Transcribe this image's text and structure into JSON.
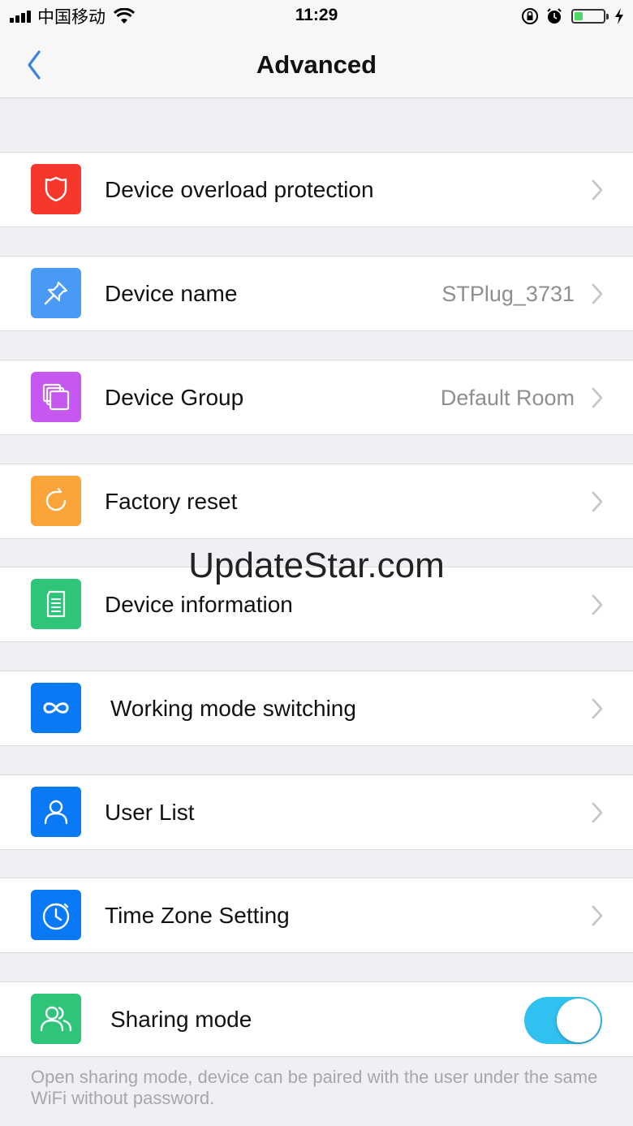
{
  "status_bar": {
    "carrier": "中国移动",
    "time": "11:29",
    "battery_level": 0.3
  },
  "nav": {
    "title": "Advanced",
    "back_icon": "chevron-left-icon"
  },
  "rows": [
    {
      "label": "Device overload protection",
      "value": "",
      "icon": "shield-icon",
      "color": "#f5382b"
    },
    {
      "label": "Device name",
      "value": "STPlug_3731",
      "icon": "pushpin-icon",
      "color": "#4a9af5"
    },
    {
      "label": "Device Group",
      "value": "Default Room",
      "icon": "stacked-squares-icon",
      "color": "#c657f0"
    },
    {
      "label": "Factory reset",
      "value": "",
      "icon": "refresh-icon",
      "color": "#fba43a"
    },
    {
      "label": "Device information",
      "value": "",
      "icon": "document-icon",
      "color": "#2ec57a"
    },
    {
      "label": "Working mode switching",
      "value": "",
      "icon": "infinity-icon",
      "color": "#0a79f5"
    },
    {
      "label": "User List",
      "value": "",
      "icon": "user-icon",
      "color": "#0a79f5"
    },
    {
      "label": "Time Zone Setting",
      "value": "",
      "icon": "stopwatch-icon",
      "color": "#0a79f5"
    }
  ],
  "sharing": {
    "label": "Sharing mode",
    "icon": "users-icon",
    "color": "#2ec57a",
    "enabled": true,
    "toggle_color": "#31c1f0",
    "note": "Open sharing mode, device can be paired with the user under the same WiFi without  password."
  },
  "watermark": "UpdateStar.com"
}
